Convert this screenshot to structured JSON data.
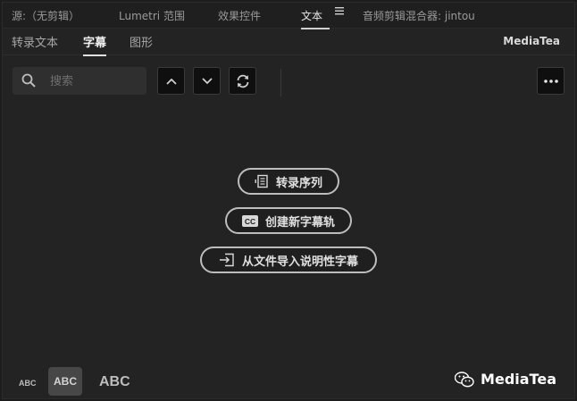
{
  "top_tabs": [
    {
      "label": "源:（无剪辑）"
    },
    {
      "label": "Lumetri 范围"
    },
    {
      "label": "效果控件"
    },
    {
      "label": "文本"
    },
    {
      "label": "音频剪辑混合器: jintou"
    }
  ],
  "top_menu_icon": "hamburger-icon",
  "sub_tabs": [
    {
      "label": "转录文本"
    },
    {
      "label": "字幕"
    },
    {
      "label": "图形"
    }
  ],
  "brand_top": "MediaTea",
  "search": {
    "placeholder": "搜索",
    "value": ""
  },
  "toolbar": {
    "up_icon": "chevron-up-icon",
    "down_icon": "chevron-down-icon",
    "refresh_icon": "refresh-icon",
    "more_icon": "more-icon"
  },
  "actions": {
    "transcribe": "转录序列",
    "create_track": "创建新字幕轨",
    "import_captions": "从文件导入说明性字幕"
  },
  "text_sizes": {
    "small": "ABC",
    "medium": "ABC",
    "large": "ABC"
  },
  "brand_bottom": "MediaTea",
  "colors": {
    "background": "#232323",
    "button_border": "#bdbdbd",
    "selected_chip": "#474747"
  }
}
